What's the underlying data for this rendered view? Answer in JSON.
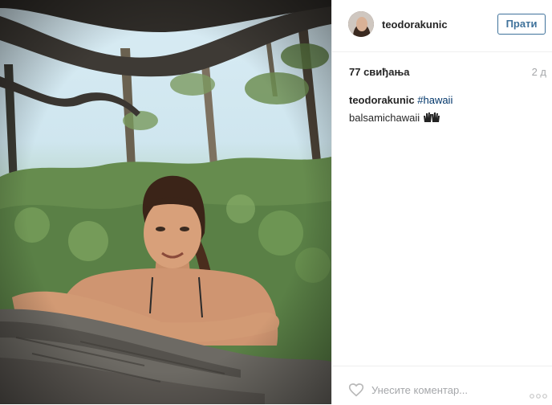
{
  "post": {
    "username": "teodorakunic",
    "follow_label": "Прати",
    "likes": "77 свиђања",
    "age": "2 д",
    "caption_user": "teodorakunic",
    "caption_tag": "#hawaii",
    "caption_line2": "balsamichawaii"
  },
  "comment": {
    "placeholder": "Унесите коментар..."
  },
  "icons": {
    "heart": "heart-outline-icon",
    "more": "more-options-icon",
    "hands": "raised-hands-emoji"
  }
}
